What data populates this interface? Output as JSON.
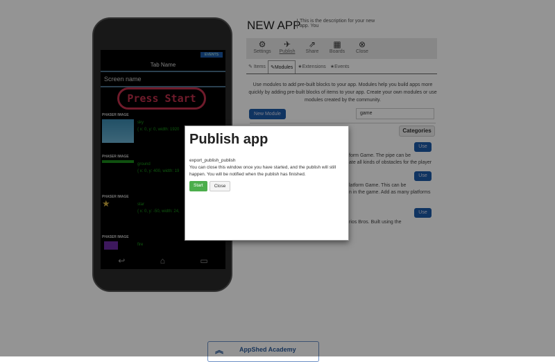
{
  "phone": {
    "events": "EVENTS",
    "tab_name": "Tab Name",
    "screen_name": "Screen name",
    "press_start": "Press Start",
    "items": [
      {
        "label": "PHASER  IMAGE",
        "name": "sky",
        "props": "{ x: 0, y: 0, width: 1920"
      },
      {
        "label": "PHASER  IMAGE",
        "name": "ground",
        "props": "{ x: 0, y: 400, width: 19"
      },
      {
        "label": "PHASER  IMAGE",
        "name": "star",
        "props": "{ x: 0, y: -50, width: 24,"
      },
      {
        "label": "PHASER  IMAGE",
        "name": "fire",
        "props": ""
      }
    ]
  },
  "app": {
    "title": "NEW APP",
    "description": "This is the description for your new app. You"
  },
  "toolbar": [
    {
      "label": "Settings",
      "icon": "gears-icon"
    },
    {
      "label": "Publish",
      "icon": "plane-icon"
    },
    {
      "label": "Share",
      "icon": "share-icon"
    },
    {
      "label": "Boards",
      "icon": "chip-icon"
    },
    {
      "label": "Close",
      "icon": "close-icon"
    }
  ],
  "tabs": [
    "Items",
    "Modules",
    "Extensions",
    "Events"
  ],
  "modules": {
    "intro": "Use modules to add pre-built blocks to your app. Modules help you build apps more quickly by adding pre-built blocks of items to your app. Create your own modules or use modules created by the community.",
    "new_module": "New Module",
    "search_value": "game",
    "categories": "Categories",
    "use": "Use",
    "desc1a": "form Game. The pipe can be",
    "desc1b": "ate all kinds of obstacles for the player",
    "desc2a": "latform Game. This can be",
    "desc2b": "n in the game. Add as many platforms",
    "desc3a": "rios Bros. Built using the"
  },
  "academy": "AppShed Academy",
  "modal": {
    "title": "Publish app",
    "key": "export_publish_publish",
    "message": "You can close this window once you have started, and the publish will still happen. You will be notified when the publish has finished.",
    "start": "Start",
    "close": "Close"
  }
}
